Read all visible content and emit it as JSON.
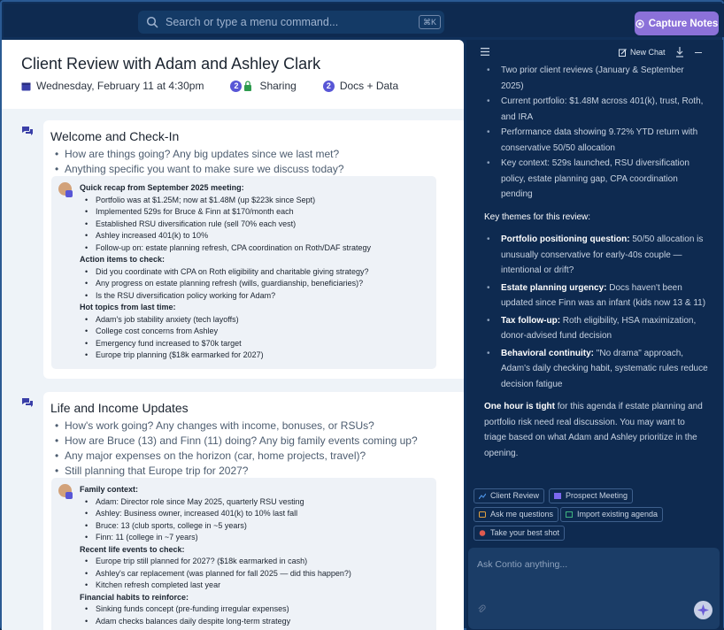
{
  "topbar": {
    "search_placeholder": "Search or type a menu command...",
    "shortcut": "⌘K",
    "capture_label": "Capture Notes"
  },
  "meeting": {
    "title": "Client Review with Adam and Ashley Clark",
    "date": "Wednesday, February 11 at 4:30pm",
    "sharing_count": "2",
    "sharing_label": "Sharing",
    "docs_count": "2",
    "docs_label": "Docs + Data"
  },
  "sections": [
    {
      "title": "Welcome and Check-In",
      "questions": [
        "How are things going? Any big updates since we last met?",
        "Anything specific you want to make sure we discuss today?"
      ],
      "notes": [
        {
          "heading": "Quick recap from September 2025 meeting:",
          "items": [
            "Portfolio was at $1.25M; now at $1.48M (up $223k since Sept)",
            "Implemented 529s for Bruce & Finn at $170/month each",
            "Established RSU diversification rule (sell 70% each vest)",
            "Ashley increased 401(k) to 10%",
            "Follow-up on: estate planning refresh, CPA coordination on Roth/DAF strategy"
          ]
        },
        {
          "heading": "Action items to check:",
          "items": [
            "Did you coordinate with CPA on Roth eligibility and charitable giving strategy?",
            "Any progress on estate planning refresh (wills, guardianship, beneficiaries)?",
            "Is the RSU diversification policy working for Adam?"
          ]
        },
        {
          "heading": "Hot topics from last time:",
          "items": [
            "Adam's job stability anxiety (tech layoffs)",
            "College cost concerns from Ashley",
            "Emergency fund increased to $70k target",
            "Europe trip planning ($18k earmarked for 2027)"
          ]
        }
      ]
    },
    {
      "title": "Life and Income Updates",
      "questions": [
        "How's work going? Any changes with income, bonuses, or RSUs?",
        "How are Bruce (13) and Finn (11) doing? Any big family events coming up?",
        "Any major expenses on the horizon (car, home projects, travel)?",
        "Still planning that Europe trip for 2027?"
      ],
      "notes": [
        {
          "heading": "Family context:",
          "items": [
            "Adam: Director role since May 2025, quarterly RSU vesting",
            "Ashley: Business owner, increased 401(k) to 10% last fall",
            "Bruce: 13 (club sports, college in ~5 years)",
            "Finn: 11 (college in ~7 years)"
          ]
        },
        {
          "heading": "Recent life events to check:",
          "items": [
            "Europe trip still planned for 2027? ($18k earmarked in cash)",
            "Ashley's car replacement (was planned for fall 2025 — did this happen?)",
            "Kitchen refresh completed last year"
          ]
        },
        {
          "heading": "Financial habits to reinforce:",
          "items": [
            "Sinking funds concept (pre-funding irregular expenses)",
            "Adam checks balances daily despite long-term strategy"
          ]
        }
      ]
    }
  ],
  "assistant": {
    "new_chat": "New Chat",
    "context_items": [
      "Two prior client reviews (January & September 2025)",
      "Current portfolio: $1.48M across 401(k), trust, Roth, and IRA",
      "Performance data showing 9.72% YTD return with conservative 50/50 allocation",
      "Key context: 529s launched, RSU diversification policy, estate planning gap, CPA coordination pending"
    ],
    "themes_heading": "Key themes for this review:",
    "themes": [
      {
        "bold": "Portfolio positioning question:",
        "text": " 50/50 allocation is unusually conservative for early-40s couple — intentional or drift?"
      },
      {
        "bold": "Estate planning urgency:",
        "text": " Docs haven't been updated since Finn was an infant (kids now 13 & 11)"
      },
      {
        "bold": "Tax follow-up:",
        "text": " Roth eligibility, HSA maximization, donor-advised fund decision"
      },
      {
        "bold": "Behavioral continuity:",
        "text": " \"No drama\" approach, Adam's daily checking habit, systematic rules reduce decision fatigue"
      }
    ],
    "closing_bold": "One hour is tight",
    "closing_text": " for this agenda if estate planning and portfolio risk need real discussion. You may want to triage based on what Adam and Ashley prioritize in the opening.",
    "chips": [
      "Client Review",
      "Prospect Meeting",
      "Ask me questions",
      "Import existing agenda",
      "Take your best shot"
    ],
    "chip_colors": [
      "#4a90e2",
      "#7b68ee",
      "#e0a040",
      "#3fb37f",
      "#e05a4f"
    ],
    "ask_placeholder": "Ask Contio anything..."
  }
}
